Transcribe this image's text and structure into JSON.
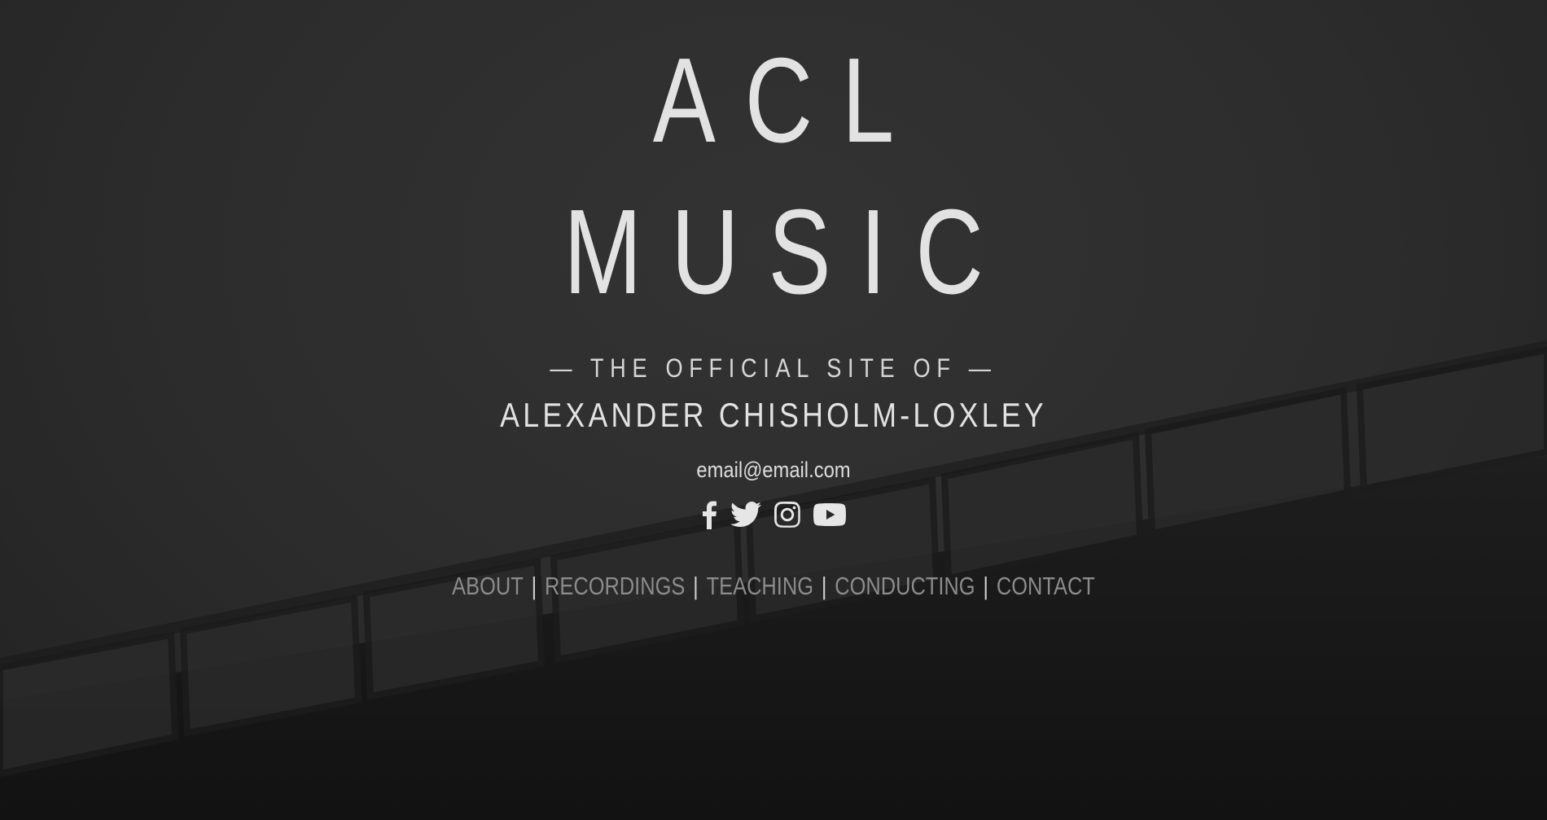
{
  "site": {
    "title_line_1": "ACL",
    "title_line_2": "MUSIC",
    "tagline": "— THE OFFICIAL SITE OF —",
    "person_name": "ALEXANDER CHISHOLM-LOXLEY",
    "email": "email@email.com"
  },
  "social_icons": [
    {
      "name": "facebook-icon"
    },
    {
      "name": "twitter-icon"
    },
    {
      "name": "instagram-icon"
    },
    {
      "name": "youtube-icon"
    }
  ],
  "nav": {
    "separator": "|",
    "items": [
      {
        "label": "ABOUT"
      },
      {
        "label": "RECORDINGS"
      },
      {
        "label": "TEACHING"
      },
      {
        "label": "CONDUCTING"
      },
      {
        "label": "CONTACT"
      }
    ]
  },
  "colors": {
    "background": "#2b2b2b",
    "text": "#e2e2e2",
    "nav_text": "#8c8c8c"
  }
}
